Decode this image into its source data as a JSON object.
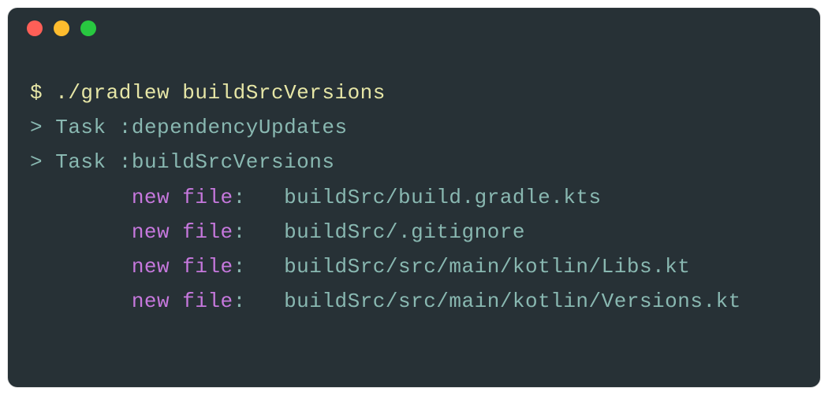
{
  "prompt": {
    "symbol": "$",
    "command": "./gradlew buildSrcVersions"
  },
  "tasks": [
    {
      "prefix": ">",
      "label": "Task",
      "name": ":dependencyUpdates"
    },
    {
      "prefix": ">",
      "label": "Task",
      "name": ":buildSrcVersions"
    }
  ],
  "files": [
    {
      "status": "new file",
      "path": "buildSrc/build.gradle.kts"
    },
    {
      "status": "new file",
      "path": "buildSrc/.gitignore"
    },
    {
      "status": "new file",
      "path": "buildSrc/src/main/kotlin/Libs.kt"
    },
    {
      "status": "new file",
      "path": "buildSrc/src/main/kotlin/Versions.kt"
    }
  ]
}
